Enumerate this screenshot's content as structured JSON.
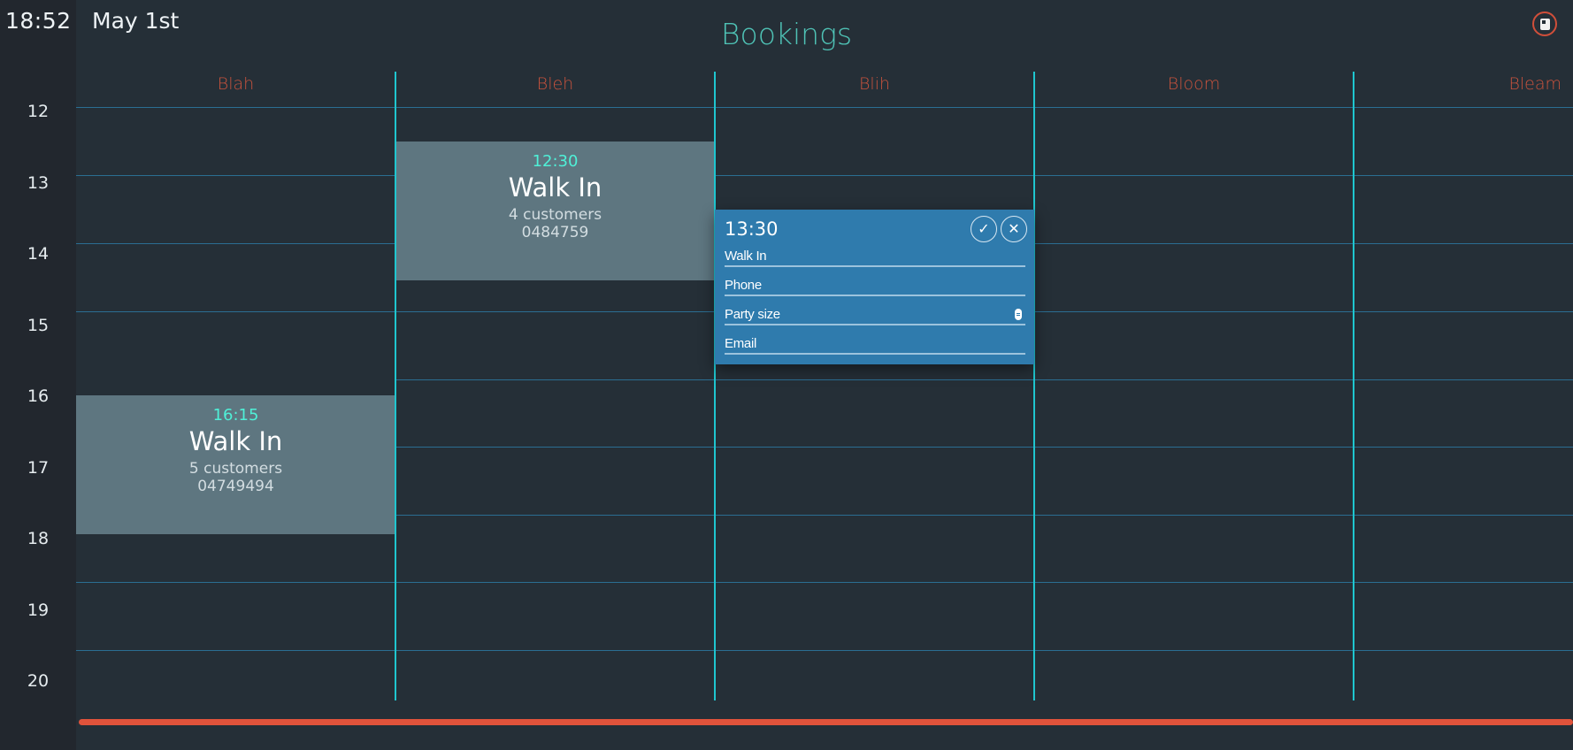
{
  "header": {
    "clock": "18:52",
    "date": "May 1st",
    "title": "Bookings"
  },
  "colors": {
    "accent": "#4fc3b6",
    "column_label": "#c9533d",
    "divider": "#1fc6cf",
    "progress_bar": "#e0533b",
    "editor_bg": "#2f7bad"
  },
  "icons": {
    "top_right": "calendar-icon",
    "confirm": "check-icon",
    "cancel": "close-icon"
  },
  "hours": [
    "12",
    "13",
    "14",
    "15",
    "16",
    "17",
    "18",
    "19",
    "20"
  ],
  "columns": [
    "Blah",
    "Bleh",
    "Blih",
    "Bloom",
    "Bleam"
  ],
  "bookings": [
    {
      "column": "Bleh",
      "time": "12:30",
      "name": "Walk In",
      "customers": "4 customers",
      "phone": "0484759"
    },
    {
      "column": "Blah",
      "time": "16:15",
      "name": "Walk In",
      "customers": "5 customers",
      "phone": "04749494"
    }
  ],
  "editor": {
    "time": "13:30",
    "confirm_symbol": "✓",
    "cancel_symbol": "✕",
    "name_value": "Walk In",
    "phone_placeholder": "Phone",
    "party_size_placeholder": "Party size",
    "email_placeholder": "Email"
  }
}
